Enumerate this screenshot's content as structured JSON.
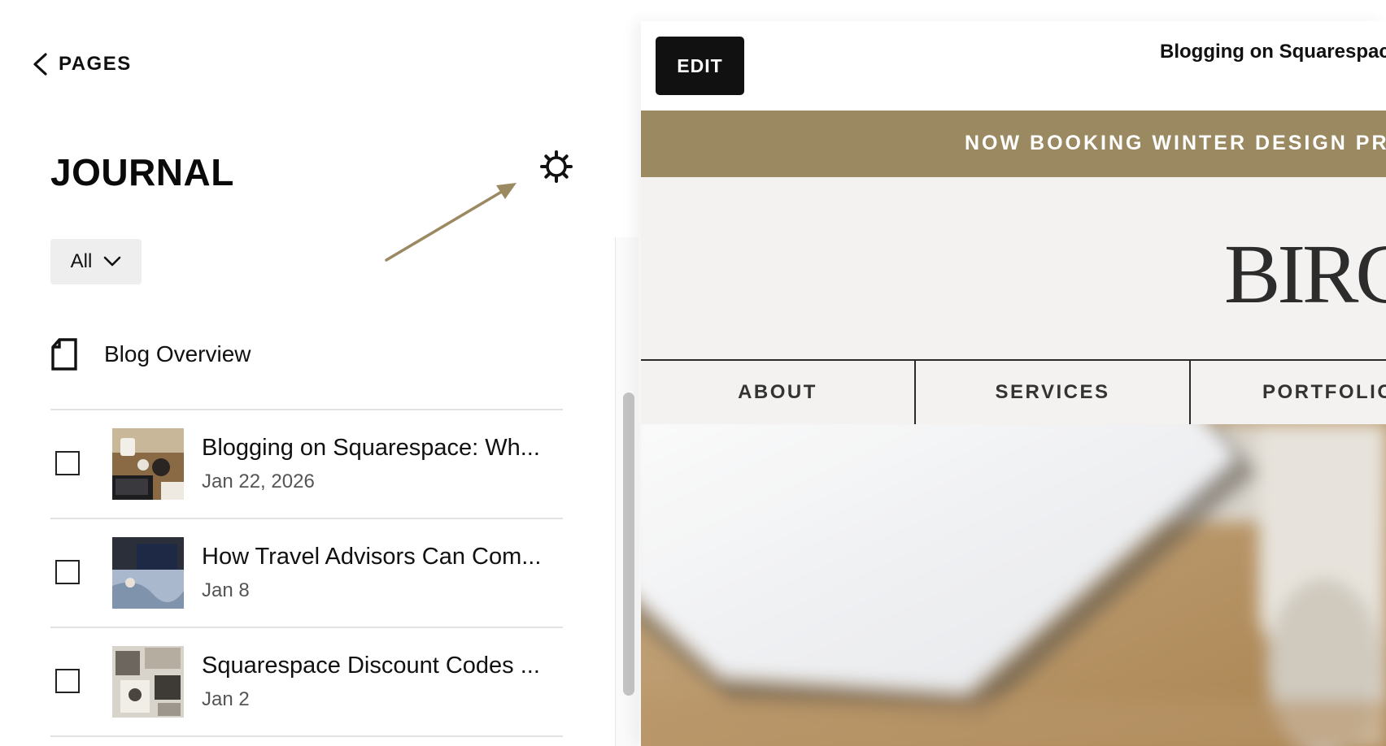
{
  "sidebar": {
    "back_label": "PAGES",
    "page_title": "JOURNAL",
    "filter": {
      "selected": "All"
    },
    "overview_label": "Blog Overview",
    "posts": [
      {
        "title": "Blogging on Squarespace: Wh...",
        "date": "Jan 22, 2026"
      },
      {
        "title": "How Travel Advisors Can Com...",
        "date": "Jan 8"
      },
      {
        "title": "Squarespace Discount Codes ...",
        "date": "Jan 2"
      }
    ]
  },
  "preview": {
    "edit_label": "EDIT",
    "page_title": "Blogging on Squarespac",
    "banner_text": "NOW BOOKING WINTER DESIGN PRO",
    "logo_text": "BIRC",
    "nav": [
      "ABOUT",
      "SERVICES",
      "PORTFOLIO"
    ]
  },
  "colors": {
    "banner": "#9b8962",
    "arrow": "#9b8962",
    "edit_button": "#111111"
  },
  "icons": [
    "chevron-left-icon",
    "gear-icon",
    "chevron-down-icon",
    "page-icon",
    "annotation-arrow"
  ]
}
